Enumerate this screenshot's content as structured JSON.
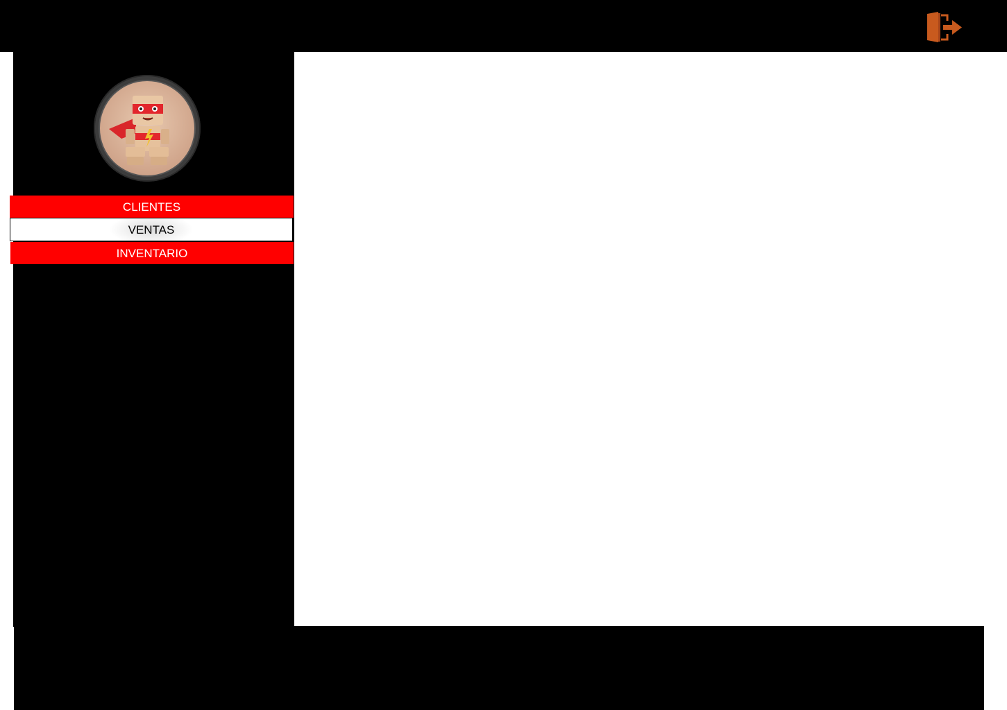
{
  "header": {
    "logout_icon": "logout-door-arrow-icon",
    "accent_color": "#c85a1e"
  },
  "sidebar": {
    "avatar_icon": "superhero-robot-avatar",
    "items": [
      {
        "label": "CLIENTES",
        "state": "default"
      },
      {
        "label": "VENTAS",
        "state": "selected"
      },
      {
        "label": "INVENTARIO",
        "state": "default"
      }
    ]
  },
  "colors": {
    "menu_red": "#ff0000",
    "menu_selected": "#ffffff",
    "chrome": "#000000"
  }
}
